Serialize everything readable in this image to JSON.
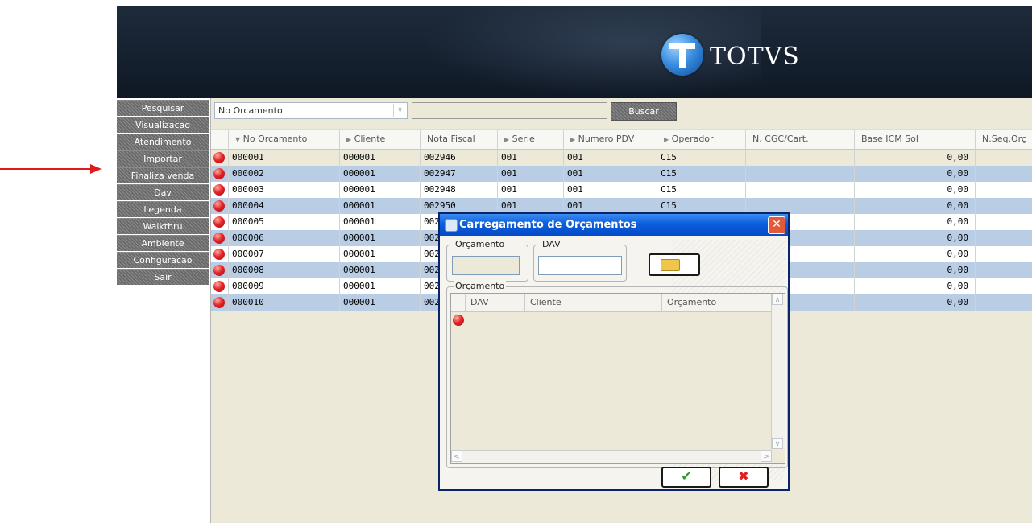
{
  "header": {
    "logo_text": "TOTVS"
  },
  "menu": {
    "items": [
      "Pesquisar",
      "Visualizacao",
      "Atendimento",
      "Importar",
      "Finaliza venda",
      "Dav",
      "Legenda",
      "Walkthru",
      "Ambiente",
      "Configuracao",
      "Sair"
    ]
  },
  "search": {
    "combo_value": "No Orcamento",
    "input_value": "",
    "button_label": "Buscar"
  },
  "grid": {
    "columns": [
      "No Orcamento",
      "Cliente",
      "Nota Fiscal",
      "Serie",
      "Numero PDV",
      "Operador",
      "N. CGC/Cart.",
      "Base ICM Sol",
      "N.Seq.Orç"
    ],
    "sort_markers": [
      "▼",
      "▶",
      "",
      "▶",
      "▶",
      "▶",
      "",
      "",
      ""
    ],
    "rows": [
      {
        "orcamento": "000001",
        "cliente": "000001",
        "nota": "002946",
        "serie": "001",
        "pdv": "001",
        "operador": "C15",
        "cgc": "",
        "base": "0,00",
        "seq": ""
      },
      {
        "orcamento": "000002",
        "cliente": "000001",
        "nota": "002947",
        "serie": "001",
        "pdv": "001",
        "operador": "C15",
        "cgc": "",
        "base": "0,00",
        "seq": ""
      },
      {
        "orcamento": "000003",
        "cliente": "000001",
        "nota": "002948",
        "serie": "001",
        "pdv": "001",
        "operador": "C15",
        "cgc": "",
        "base": "0,00",
        "seq": ""
      },
      {
        "orcamento": "000004",
        "cliente": "000001",
        "nota": "002950",
        "serie": "001",
        "pdv": "001",
        "operador": "C15",
        "cgc": "",
        "base": "0,00",
        "seq": ""
      },
      {
        "orcamento": "000005",
        "cliente": "000001",
        "nota": "002",
        "serie": "",
        "pdv": "",
        "operador": "",
        "cgc": "",
        "base": "0,00",
        "seq": ""
      },
      {
        "orcamento": "000006",
        "cliente": "000001",
        "nota": "002",
        "serie": "",
        "pdv": "",
        "operador": "",
        "cgc": "",
        "base": "0,00",
        "seq": ""
      },
      {
        "orcamento": "000007",
        "cliente": "000001",
        "nota": "002",
        "serie": "",
        "pdv": "",
        "operador": "",
        "cgc": "",
        "base": "0,00",
        "seq": ""
      },
      {
        "orcamento": "000008",
        "cliente": "000001",
        "nota": "002",
        "serie": "",
        "pdv": "",
        "operador": "",
        "cgc": "",
        "base": "0,00",
        "seq": ""
      },
      {
        "orcamento": "000009",
        "cliente": "000001",
        "nota": "002",
        "serie": "",
        "pdv": "",
        "operador": "",
        "cgc": "",
        "base": "0,00",
        "seq": ""
      },
      {
        "orcamento": "000010",
        "cliente": "000001",
        "nota": "002",
        "serie": "",
        "pdv": "",
        "operador": "",
        "cgc": "",
        "base": "0,00",
        "seq": ""
      }
    ]
  },
  "dialog": {
    "title": "Carregamento de Orçamentos",
    "close_glyph": "✕",
    "group_orcamento_label": "Orçamento",
    "orcamento_value": "",
    "group_dav_label": "DAV",
    "dav_value": "",
    "list_group_label": "Orçamento",
    "list_columns": [
      "DAV",
      "Cliente",
      "Orçamento"
    ],
    "ok_glyph": "✔",
    "cancel_glyph": "✖"
  },
  "colors": {
    "header_bg": "#1b2636",
    "row_alt": "#b9cde5",
    "status_red": "#e4252b",
    "dialog_title": "#0a5fdc",
    "arrow": "#e0191b"
  },
  "icons": [
    "red-status-dot-icon",
    "folder-icon",
    "checkmark-icon",
    "close-icon",
    "arrow-annotation"
  ]
}
